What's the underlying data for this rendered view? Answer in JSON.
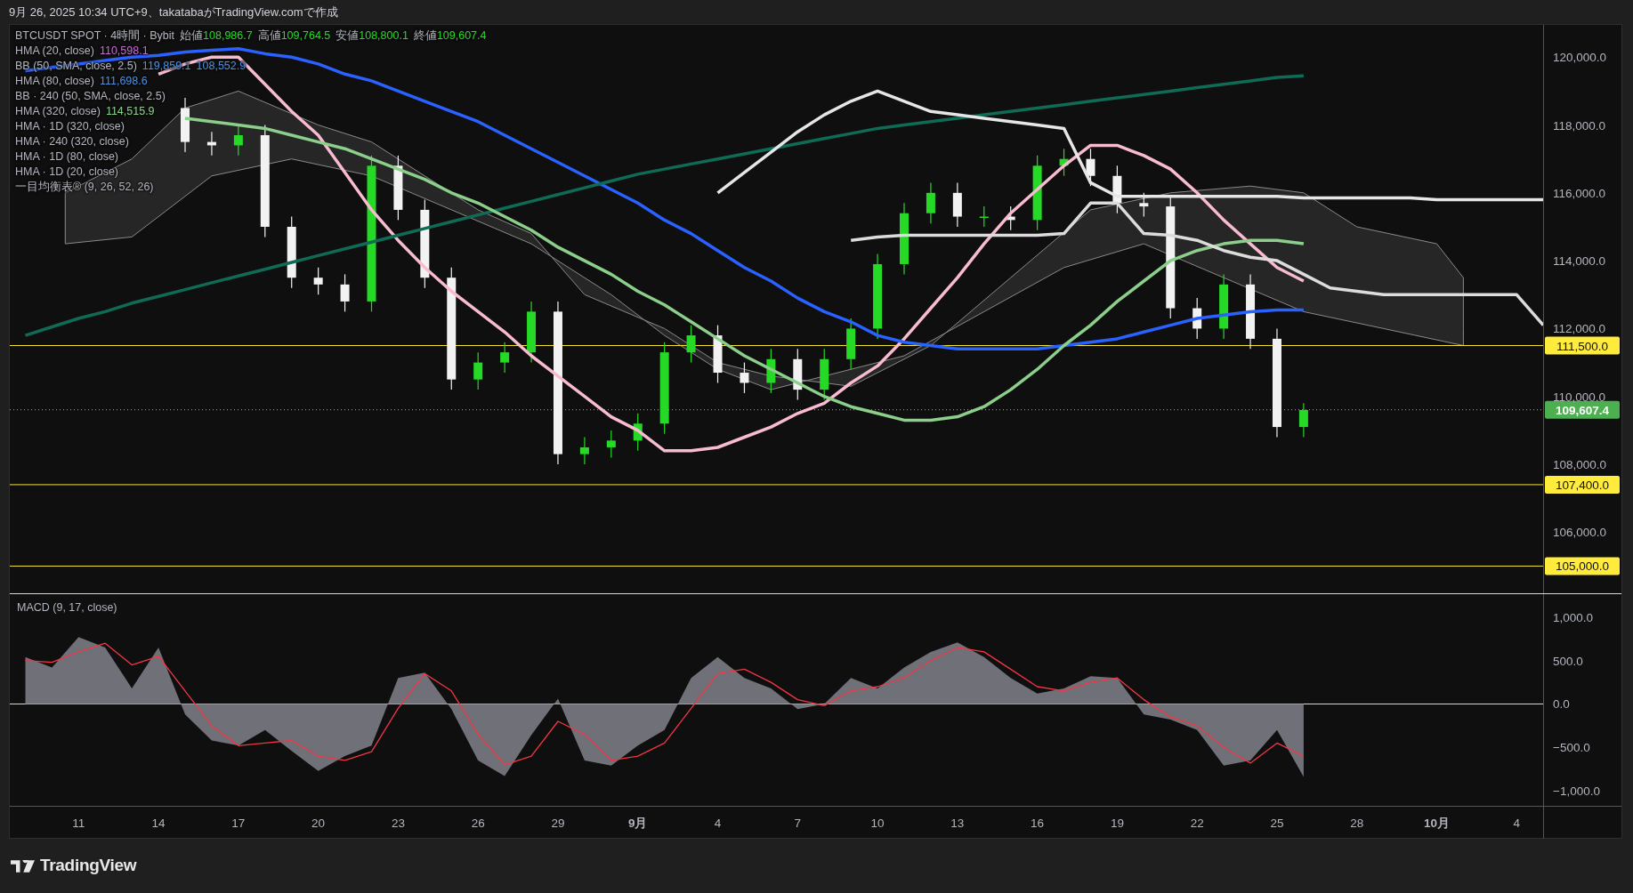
{
  "header": {
    "text": "9月 26, 2025 10:34 UTC+9、takatabaがTradingView.comで作成"
  },
  "legend": {
    "symbol": "BTCUSDT SPOT · 4時間 · Bybit",
    "ohlc": [
      {
        "label": "始値",
        "value": "108,986.7"
      },
      {
        "label": "高値",
        "value": "109,764.5"
      },
      {
        "label": "安値",
        "value": "108,800.1"
      },
      {
        "label": "終値",
        "value": "109,607.4"
      }
    ],
    "indicators": [
      {
        "name": "HMA (20, close)",
        "values": [
          "110,598.1"
        ],
        "color": "#c46bd1"
      },
      {
        "name": "BB (50, SMA, close, 2.5)",
        "values": [
          "119,859.1",
          "108,552.9"
        ],
        "color": "#4c8fe0"
      },
      {
        "name": "HMA (80, close)",
        "values": [
          "111,698.6"
        ],
        "color": "#4c8fe0"
      },
      {
        "name": "BB · 240 (50, SMA, close, 2.5)"
      },
      {
        "name": "HMA (320, close)",
        "values": [
          "114,515.9"
        ],
        "color": "#8bcf8b"
      },
      {
        "name": "HMA · 1D (320, close)"
      },
      {
        "name": "HMA · 240 (320, close)"
      },
      {
        "name": "HMA · 1D (80, close)"
      },
      {
        "name": "HMA · 1D (20, close)"
      },
      {
        "name": "一目均衡表® (9, 26, 52, 26)"
      }
    ]
  },
  "main": {
    "chart_data": {
      "type": "candlestick",
      "x": [
        "2025-08-09",
        "2025-08-10",
        "2025-08-11",
        "2025-08-12",
        "2025-08-13",
        "2025-08-14",
        "2025-08-15",
        "2025-08-16",
        "2025-08-17",
        "2025-08-18",
        "2025-08-19",
        "2025-08-20",
        "2025-08-21",
        "2025-08-22",
        "2025-08-23",
        "2025-08-24",
        "2025-08-25",
        "2025-08-26",
        "2025-08-27",
        "2025-08-28",
        "2025-08-29",
        "2025-08-30",
        "2025-08-31",
        "2025-09-01",
        "2025-09-02",
        "2025-09-03",
        "2025-09-04",
        "2025-09-05",
        "2025-09-06",
        "2025-09-07",
        "2025-09-08",
        "2025-09-09",
        "2025-09-10",
        "2025-09-11",
        "2025-09-12",
        "2025-09-13",
        "2025-09-14",
        "2025-09-15",
        "2025-09-16",
        "2025-09-17",
        "2025-09-18",
        "2025-09-19",
        "2025-09-20",
        "2025-09-21",
        "2025-09-22",
        "2025-09-23",
        "2025-09-24",
        "2025-09-25",
        "2025-09-26",
        "2025-09-27",
        "2025-09-28",
        "2025-09-29",
        "2025-09-30",
        "2025-10-01",
        "2025-10-02",
        "2025-10-03",
        "2025-10-04",
        "2025-10-05"
      ],
      "series": [
        {
          "type": "line",
          "color": "#f8bbd0",
          "values": [
            null,
            null,
            null,
            null,
            null,
            119500,
            119800,
            120000,
            120000,
            119200,
            118400,
            117700,
            116600,
            115500,
            114600,
            113800,
            113100,
            112500,
            111900,
            111200,
            110600,
            110000,
            109400,
            109000,
            108400,
            108400,
            108500,
            108800,
            109100,
            109500,
            109800,
            110400,
            110900,
            111700,
            112600,
            113500,
            114500,
            115400,
            116100,
            116800,
            117400,
            117400,
            117100,
            116700,
            116000,
            115200,
            114500,
            113800,
            113400,
            null,
            null,
            null,
            null,
            null,
            null,
            null,
            null,
            null
          ]
        },
        {
          "type": "line",
          "color": "#2962ff",
          "values": [
            119600,
            119700,
            119800,
            119900,
            120000,
            120050,
            120150,
            120200,
            120250,
            120100,
            120000,
            119800,
            119500,
            119300,
            119000,
            118700,
            118400,
            118100,
            117700,
            117300,
            116900,
            116500,
            116100,
            115700,
            115200,
            114800,
            114300,
            113800,
            113400,
            112900,
            112500,
            112200,
            111800,
            111600,
            111500,
            111400,
            111400,
            111400,
            111400,
            111500,
            111600,
            111700,
            111900,
            112100,
            112300,
            112400,
            112500,
            112550,
            112550,
            null,
            null,
            null,
            null,
            null,
            null,
            null,
            null,
            null
          ]
        },
        {
          "type": "line",
          "color": "#0f6b55",
          "values": [
            111800,
            112050,
            112300,
            112500,
            112750,
            112950,
            113150,
            113350,
            113550,
            113750,
            113950,
            114150,
            114350,
            114550,
            114750,
            114950,
            115150,
            115350,
            115550,
            115750,
            115950,
            116150,
            116350,
            116550,
            116700,
            116850,
            117000,
            117150,
            117300,
            117450,
            117600,
            117750,
            117900,
            118000,
            118100,
            118200,
            118300,
            118400,
            118500,
            118600,
            118700,
            118800,
            118900,
            119000,
            119100,
            119200,
            119300,
            119400,
            119450,
            null,
            null,
            null,
            null,
            null,
            null,
            null,
            null,
            null
          ]
        },
        {
          "type": "line",
          "color": "#8bcf8b",
          "values": [
            null,
            null,
            null,
            null,
            null,
            null,
            118200,
            118100,
            118000,
            117900,
            117700,
            117500,
            117300,
            117000,
            116700,
            116400,
            116000,
            115700,
            115300,
            114900,
            114400,
            114000,
            113600,
            113100,
            112700,
            112200,
            111700,
            111200,
            110800,
            110400,
            110000,
            109700,
            109500,
            109300,
            109300,
            109400,
            109700,
            110200,
            110800,
            111500,
            112100,
            112800,
            113400,
            114000,
            114300,
            114500,
            114600,
            114600,
            114500,
            null,
            null,
            null,
            null,
            null,
            null,
            null,
            null,
            null
          ]
        },
        {
          "type": "line",
          "color": "#e6e6e6",
          "values": [
            null,
            null,
            null,
            null,
            null,
            null,
            null,
            null,
            null,
            null,
            null,
            null,
            null,
            null,
            null,
            null,
            null,
            null,
            null,
            null,
            null,
            null,
            null,
            null,
            null,
            null,
            116000,
            116600,
            117200,
            117800,
            118300,
            118700,
            119000,
            118700,
            118400,
            118300,
            118200,
            118100,
            118000,
            117900,
            116300,
            115900,
            115900,
            115900,
            115900,
            115900,
            115900,
            115900,
            115850,
            115850,
            115850,
            115850,
            115850,
            115800,
            115800,
            115800,
            115800,
            115800
          ]
        },
        {
          "type": "line",
          "color": "#dcdcdc",
          "values": [
            null,
            null,
            null,
            null,
            null,
            null,
            null,
            null,
            null,
            null,
            null,
            null,
            null,
            null,
            null,
            null,
            null,
            null,
            null,
            null,
            null,
            null,
            null,
            null,
            null,
            null,
            null,
            null,
            null,
            null,
            null,
            114600,
            114700,
            114750,
            114750,
            114750,
            114750,
            114750,
            114750,
            114800,
            115700,
            115700,
            114800,
            114750,
            114600,
            114300,
            114100,
            114000,
            113600,
            113200,
            113100,
            113000,
            113000,
            113000,
            113000,
            113000,
            113000,
            112100
          ]
        }
      ],
      "ohlc": [
        null,
        null,
        null,
        null,
        null,
        null,
        [
          118500,
          118800,
          117200,
          117500
        ],
        [
          117500,
          117800,
          117100,
          117400
        ],
        [
          117400,
          118000,
          117100,
          117700
        ],
        [
          117700,
          118000,
          114700,
          115000
        ],
        [
          115000,
          115300,
          113200,
          113500
        ],
        [
          113500,
          113800,
          113000,
          113300
        ],
        [
          113300,
          113600,
          112500,
          112800
        ],
        [
          112800,
          117100,
          112500,
          116800
        ],
        [
          116800,
          117100,
          115200,
          115500
        ],
        [
          115500,
          115800,
          113200,
          113500
        ],
        [
          113500,
          113800,
          110200,
          110500
        ],
        [
          110500,
          111300,
          110200,
          111000
        ],
        [
          111000,
          111600,
          110700,
          111300
        ],
        [
          111300,
          112800,
          111000,
          112500
        ],
        [
          112500,
          112800,
          108000,
          108300
        ],
        [
          108300,
          108800,
          108000,
          108500
        ],
        [
          108500,
          109000,
          108200,
          108700
        ],
        [
          108700,
          109500,
          108400,
          109200
        ],
        [
          109200,
          111600,
          108900,
          111300
        ],
        [
          111300,
          112100,
          111000,
          111800
        ],
        [
          111800,
          112100,
          110400,
          110700
        ],
        [
          110700,
          111000,
          110100,
          110400
        ],
        [
          110400,
          111400,
          110100,
          111100
        ],
        [
          111100,
          111400,
          109900,
          110200
        ],
        [
          110200,
          111400,
          109900,
          111100
        ],
        [
          111100,
          112300,
          110800,
          112000
        ],
        [
          112000,
          114200,
          111700,
          113900
        ],
        [
          113900,
          115700,
          113600,
          115400
        ],
        [
          115400,
          116300,
          115100,
          116000
        ],
        [
          116000,
          116300,
          115000,
          115300
        ],
        [
          115300,
          115600,
          115000,
          115300
        ],
        [
          115300,
          115600,
          114900,
          115200
        ],
        [
          115200,
          117100,
          114900,
          116800
        ],
        [
          116800,
          117300,
          116500,
          117000
        ],
        [
          117000,
          117300,
          116200,
          116500
        ],
        [
          116500,
          116800,
          115400,
          115700
        ],
        [
          115700,
          116000,
          115300,
          115600
        ],
        [
          115600,
          115900,
          112300,
          112600
        ],
        [
          112600,
          112900,
          111700,
          112000
        ],
        [
          112000,
          113600,
          111700,
          113300
        ],
        [
          113300,
          113600,
          111400,
          111700
        ],
        [
          111700,
          112000,
          108800,
          109100
        ],
        [
          109100,
          109800,
          108800,
          109600
        ],
        null,
        null,
        null,
        null,
        null,
        null,
        null,
        null,
        null
      ],
      "xlim": [
        "2025-08-08T10:00",
        "2025-10-08"
      ],
      "ylim": [
        104200,
        120950
      ],
      "yticks": [
        {
          "value": 106000,
          "label": "106,000.0"
        },
        {
          "value": 108000,
          "label": "108,000.0"
        },
        {
          "value": 110000,
          "label": "110,000.0"
        },
        {
          "value": 112000,
          "label": "112,000.0"
        },
        {
          "value": 114000,
          "label": "114,000.0"
        },
        {
          "value": 116000,
          "label": "116,000.0"
        },
        {
          "value": 118000,
          "label": "118,000.0"
        },
        {
          "value": 120000,
          "label": "120,000.0"
        }
      ],
      "ref_lines": [
        {
          "axis": "y",
          "value": 111500,
          "label": "111,500.0"
        },
        {
          "axis": "y",
          "value": 109607.4,
          "label": "109,607.4"
        },
        {
          "axis": "y",
          "value": 107400,
          "label": "107,400.0"
        },
        {
          "axis": "y",
          "value": 105000,
          "label": "105,000.0"
        }
      ]
    }
  },
  "macd": {
    "label": "MACD (9, 17, close)",
    "chart_data": {
      "type": "area",
      "x": [
        "2025-08-09",
        "2025-08-10",
        "2025-08-11",
        "2025-08-12",
        "2025-08-13",
        "2025-08-14",
        "2025-08-15",
        "2025-08-16",
        "2025-08-17",
        "2025-08-18",
        "2025-08-19",
        "2025-08-20",
        "2025-08-21",
        "2025-08-22",
        "2025-08-23",
        "2025-08-24",
        "2025-08-25",
        "2025-08-26",
        "2025-08-27",
        "2025-08-28",
        "2025-08-29",
        "2025-08-30",
        "2025-08-31",
        "2025-09-01",
        "2025-09-02",
        "2025-09-03",
        "2025-09-04",
        "2025-09-05",
        "2025-09-06",
        "2025-09-07",
        "2025-09-08",
        "2025-09-09",
        "2025-09-10",
        "2025-09-11",
        "2025-09-12",
        "2025-09-13",
        "2025-09-14",
        "2025-09-15",
        "2025-09-16",
        "2025-09-17",
        "2025-09-18",
        "2025-09-19",
        "2025-09-20",
        "2025-09-21",
        "2025-09-22",
        "2025-09-23",
        "2025-09-24",
        "2025-09-25",
        "2025-09-26"
      ],
      "series": [
        {
          "type": "area",
          "color": "#6f7078",
          "values": [
            540,
            420,
            770,
            650,
            180,
            650,
            -120,
            -420,
            -480,
            -300,
            -540,
            -770,
            -600,
            -480,
            300,
            360,
            -60,
            -650,
            -830,
            -360,
            60,
            -650,
            -710,
            -480,
            -300,
            300,
            540,
            300,
            180,
            -60,
            0,
            300,
            180,
            420,
            600,
            710,
            540,
            300,
            120,
            180,
            320,
            300,
            -120,
            -180,
            -300,
            -710,
            -650,
            -300,
            -840
          ]
        },
        {
          "type": "line",
          "color": "#f23645",
          "values": [
            500,
            480,
            600,
            700,
            450,
            550,
            150,
            -250,
            -480,
            -450,
            -420,
            -600,
            -650,
            -550,
            -50,
            350,
            150,
            -350,
            -700,
            -600,
            -200,
            -350,
            -650,
            -600,
            -450,
            -50,
            350,
            400,
            250,
            50,
            -20,
            150,
            200,
            300,
            500,
            650,
            600,
            400,
            200,
            150,
            250,
            300,
            50,
            -150,
            -250,
            -500,
            -680,
            -450,
            -600
          ]
        }
      ],
      "xlim": [
        "2025-08-08T10:00",
        "2025-10-08"
      ],
      "ylim": [
        -1173,
        1265
      ],
      "xticks": [
        {
          "value": "2025-08-11",
          "label": "11"
        },
        {
          "value": "2025-08-14",
          "label": "14"
        },
        {
          "value": "2025-08-17",
          "label": "17"
        },
        {
          "value": "2025-08-20",
          "label": "20"
        },
        {
          "value": "2025-08-23",
          "label": "23"
        },
        {
          "value": "2025-08-26",
          "label": "26"
        },
        {
          "value": "2025-08-29",
          "label": "29"
        },
        {
          "value": "2025-09-01",
          "label": "9月"
        },
        {
          "value": "2025-09-04",
          "label": "4"
        },
        {
          "value": "2025-09-07",
          "label": "7"
        },
        {
          "value": "2025-09-10",
          "label": "10"
        },
        {
          "value": "2025-09-13",
          "label": "13"
        },
        {
          "value": "2025-09-16",
          "label": "16"
        },
        {
          "value": "2025-09-19",
          "label": "19"
        },
        {
          "value": "2025-09-22",
          "label": "22"
        },
        {
          "value": "2025-09-25",
          "label": "25"
        },
        {
          "value": "2025-09-28",
          "label": "28"
        },
        {
          "value": "2025-10-01",
          "label": "10月"
        },
        {
          "value": "2025-10-04",
          "label": "4"
        }
      ],
      "yticks": [
        {
          "value": -1000,
          "label": "−1,000.0"
        },
        {
          "value": -500,
          "label": "−500.0"
        },
        {
          "value": 0,
          "label": "0.0"
        },
        {
          "value": 500,
          "label": "500.0"
        },
        {
          "value": 1000,
          "label": "1,000.0"
        }
      ]
    }
  },
  "footer": {
    "logo": "TradingView"
  }
}
